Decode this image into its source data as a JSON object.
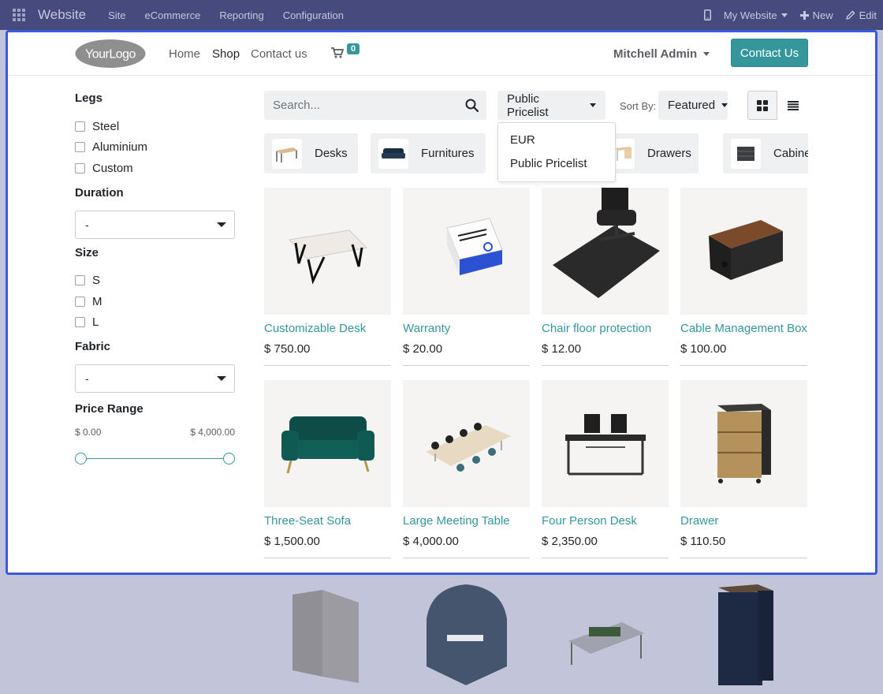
{
  "topbar": {
    "app_name": "Website",
    "menu": [
      "Site",
      "eCommerce",
      "Reporting",
      "Configuration"
    ],
    "website_selector": "My Website",
    "new_label": "New",
    "edit_label": "Edit"
  },
  "header": {
    "logo_text": "YourLogo",
    "nav": [
      "Home",
      "Shop",
      "Contact us"
    ],
    "active_nav": "Shop",
    "cart_count": "0",
    "user_name": "Mitchell Admin",
    "contact_button": "Contact Us"
  },
  "filters": {
    "legs": {
      "title": "Legs",
      "options": [
        "Steel",
        "Aluminium",
        "Custom"
      ]
    },
    "duration": {
      "title": "Duration",
      "value": "-"
    },
    "size": {
      "title": "Size",
      "options": [
        "S",
        "M",
        "L"
      ]
    },
    "fabric": {
      "title": "Fabric",
      "value": "-"
    },
    "price_range": {
      "title": "Price Range",
      "min": "$ 0.00",
      "max": "$ 4,000.00",
      "min_fraction": 0,
      "max_fraction": 1
    }
  },
  "toolbar": {
    "search_placeholder": "Search...",
    "pricelist_button": "Public Pricelist",
    "pricelist_menu": [
      "EUR",
      "Public Pricelist"
    ],
    "sort_label": "Sort By:",
    "sort_value": "Featured",
    "active_view": "grid"
  },
  "categories": [
    "Desks",
    "Furnitures",
    "Drawers",
    "Cabinets"
  ],
  "products": [
    {
      "name": "Customizable Desk",
      "price": "$ 750.00",
      "icon": "desk-icon"
    },
    {
      "name": "Warranty",
      "price": "$ 20.00",
      "icon": "warranty-box-icon"
    },
    {
      "name": "Chair floor protection",
      "price": "$ 12.00",
      "icon": "chair-mat-icon"
    },
    {
      "name": "Cable Management Box",
      "price": "$ 100.00",
      "icon": "cable-box-icon"
    },
    {
      "name": "Three-Seat Sofa",
      "price": "$ 1,500.00",
      "icon": "sofa-icon"
    },
    {
      "name": "Large Meeting Table",
      "price": "$ 4,000.00",
      "icon": "meeting-table-icon"
    },
    {
      "name": "Four Person Desk",
      "price": "$ 2,350.00",
      "icon": "four-person-desk-icon"
    },
    {
      "name": "Drawer",
      "price": "$ 110.50",
      "icon": "drawer-cabinet-icon"
    }
  ],
  "colors": {
    "topbar": "#464a7c",
    "accent": "#35979c",
    "frame_border": "#3b59dc",
    "overlay": "#c2c5d9"
  }
}
